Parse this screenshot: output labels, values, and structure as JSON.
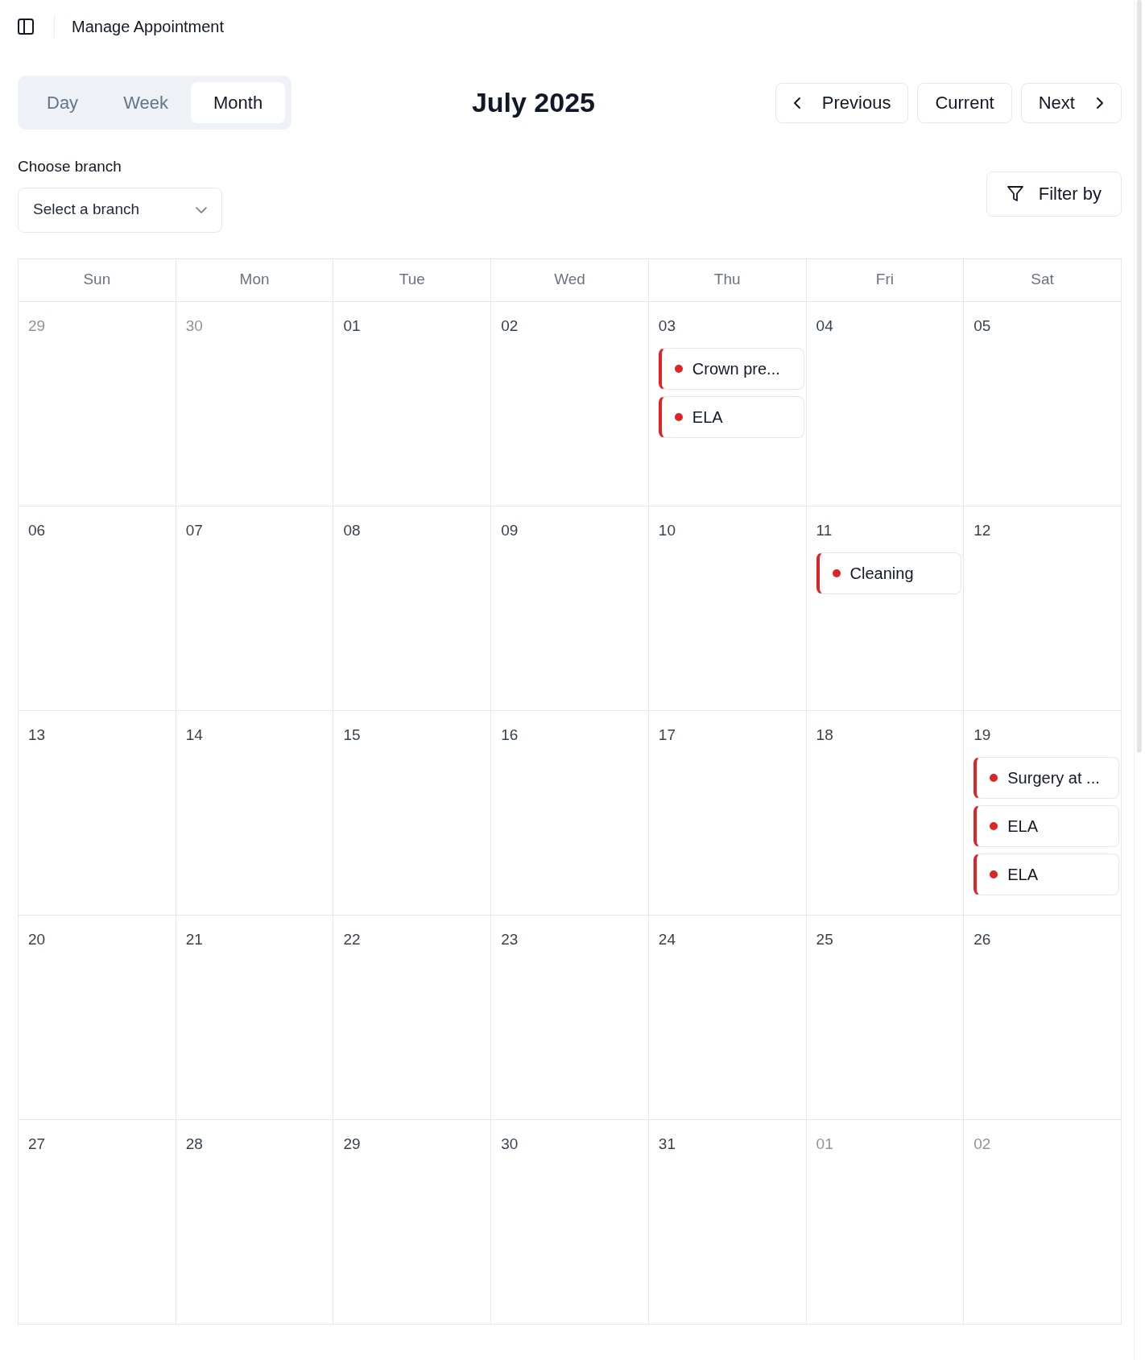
{
  "header": {
    "title": "Manage Appointment"
  },
  "view_tabs": [
    {
      "label": "Day",
      "selected": false
    },
    {
      "label": "Week",
      "selected": false
    },
    {
      "label": "Month",
      "selected": true
    }
  ],
  "period_title": "July 2025",
  "nav_buttons": [
    {
      "label": "Previous",
      "kind": "previous"
    },
    {
      "label": "Current",
      "kind": "current"
    },
    {
      "label": "Next",
      "kind": "next"
    }
  ],
  "branch_select": {
    "label": "Choose branch",
    "placeholder": "Select a branch"
  },
  "filter_button": {
    "label": "Filter by"
  },
  "calendar": {
    "weekdays": [
      "Sun",
      "Mon",
      "Tue",
      "Wed",
      "Thu",
      "Fri",
      "Sat"
    ],
    "weeks": [
      [
        {
          "day": "29",
          "in_month": false
        },
        {
          "day": "30",
          "in_month": false
        },
        {
          "day": "01",
          "in_month": true
        },
        {
          "day": "02",
          "in_month": true
        },
        {
          "day": "03",
          "in_month": true,
          "events": [
            "Crown pre...",
            "ELA"
          ]
        },
        {
          "day": "04",
          "in_month": true
        },
        {
          "day": "05",
          "in_month": true
        }
      ],
      [
        {
          "day": "06",
          "in_month": true
        },
        {
          "day": "07",
          "in_month": true
        },
        {
          "day": "08",
          "in_month": true
        },
        {
          "day": "09",
          "in_month": true
        },
        {
          "day": "10",
          "in_month": true
        },
        {
          "day": "11",
          "in_month": true,
          "events": [
            "Cleaning"
          ]
        },
        {
          "day": "12",
          "in_month": true
        }
      ],
      [
        {
          "day": "13",
          "in_month": true
        },
        {
          "day": "14",
          "in_month": true
        },
        {
          "day": "15",
          "in_month": true
        },
        {
          "day": "16",
          "in_month": true
        },
        {
          "day": "17",
          "in_month": true
        },
        {
          "day": "18",
          "in_month": true
        },
        {
          "day": "19",
          "in_month": true,
          "events": [
            "Surgery at ...",
            "ELA",
            "ELA"
          ]
        }
      ],
      [
        {
          "day": "20",
          "in_month": true
        },
        {
          "day": "21",
          "in_month": true
        },
        {
          "day": "22",
          "in_month": true
        },
        {
          "day": "23",
          "in_month": true
        },
        {
          "day": "24",
          "in_month": true
        },
        {
          "day": "25",
          "in_month": true
        },
        {
          "day": "26",
          "in_month": true
        }
      ],
      [
        {
          "day": "27",
          "in_month": true
        },
        {
          "day": "28",
          "in_month": true
        },
        {
          "day": "29",
          "in_month": true
        },
        {
          "day": "30",
          "in_month": true
        },
        {
          "day": "31",
          "in_month": true
        },
        {
          "day": "01",
          "in_month": false
        },
        {
          "day": "02",
          "in_month": false
        }
      ]
    ]
  }
}
